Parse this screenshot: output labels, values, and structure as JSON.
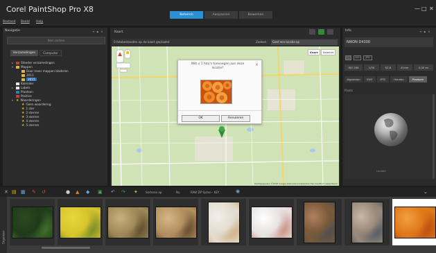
{
  "app": {
    "title": "Corel PaintShop Pro X8",
    "window_controls": [
      "—",
      "□",
      "✕"
    ],
    "tabs": [
      {
        "label": "Beheren",
        "active": true
      },
      {
        "label": "Aanpassen",
        "active": false
      },
      {
        "label": "Bewerken",
        "active": false
      }
    ],
    "menu": [
      "Bestand",
      "Beeld",
      "Help"
    ]
  },
  "navigator": {
    "title": "Navigatie",
    "panel_controls": "▾ ▪ ✕",
    "search_placeholder": "Niet zoeken",
    "tabs": [
      "Verzamelingen",
      "Computer"
    ],
    "tree": [
      {
        "label": "Sfeeder verzamelingen",
        "icon": "red",
        "tri": "▸",
        "indent": 0
      },
      {
        "label": "Mappen",
        "icon": "folder",
        "tri": "▾",
        "indent": 0
      },
      {
        "label": "Door meer mappen bladeren",
        "icon": "folder",
        "tri": "",
        "indent": 1
      },
      {
        "label": "2011",
        "icon": "folder",
        "tri": "",
        "indent": 1
      },
      {
        "label": "2015",
        "icon": "folder",
        "tri": "",
        "indent": 1,
        "selected": true
      },
      {
        "label": "Kalender",
        "icon": "white",
        "tri": "",
        "indent": 0
      },
      {
        "label": "Labels",
        "icon": "white",
        "tri": "▸",
        "indent": 0
      },
      {
        "label": "Plaatsen",
        "icon": "blue",
        "tri": "",
        "indent": 0
      },
      {
        "label": "Posities",
        "icon": "red",
        "tri": "",
        "indent": 0
      },
      {
        "label": "Waarderingen",
        "icon": "star",
        "tri": "▾",
        "indent": 0
      },
      {
        "label": "Geen waardering",
        "icon": "star",
        "tri": "",
        "indent": 1
      },
      {
        "label": "1 ster",
        "icon": "star",
        "tri": "",
        "indent": 1
      },
      {
        "label": "2 sterren",
        "icon": "star",
        "tri": "",
        "indent": 1
      },
      {
        "label": "3 sterren",
        "icon": "star",
        "tri": "",
        "indent": 1
      },
      {
        "label": "4 sterren",
        "icon": "star",
        "tri": "",
        "indent": 1
      },
      {
        "label": "5 sterren",
        "icon": "star",
        "tri": "",
        "indent": 1
      }
    ]
  },
  "map": {
    "title": "Kaart",
    "subtitle": "0 fotobestanden op de kaart geplaatst",
    "search_label": "Zoeken",
    "search_value": "Geef een locatie op",
    "map_types": [
      "Kaart",
      "Satelliet"
    ],
    "attribution": "Kaartgegevens ©2015 Google   Gebruiksvoorwaarden   Een kaartfout rapporteren",
    "dialog": {
      "text": "Wilt u 1 foto's toevoegen aan deze locatie?",
      "close": "×",
      "ok": "OK",
      "cancel": "Annuleren"
    }
  },
  "info": {
    "title": "Info",
    "camera": "NIKON D4300",
    "icons": [
      "ISO",
      "JPG"
    ],
    "exif": [
      "ISO 200",
      "1/30",
      "f/2,8",
      "8 mm",
      "0,00 ev"
    ],
    "tabs": [
      "Algemeen",
      "EXIF",
      "IPTC",
      "Herzien",
      "Plaatsen"
    ],
    "active_tab": "Plaatsen",
    "places_label": "Plaats",
    "location_label": "Locatie"
  },
  "toolbar": {
    "sort_label": "Sorteren op",
    "sort_icon_label": "Nu",
    "raw_label": "RAW ZIP lijsten · KEY"
  },
  "organizer": {
    "side_label": "Organizer",
    "thumbnails": [
      {
        "name": "leaf",
        "colors": [
          "#1f3a1a",
          "#4f7f32",
          "#2a4a1f"
        ]
      },
      {
        "name": "yellow-flower",
        "colors": [
          "#d8c52a",
          "#5a7a2a",
          "#e7d640"
        ]
      },
      {
        "name": "leopard-1",
        "colors": [
          "#a08a5a",
          "#4a3a22",
          "#c8b07a"
        ]
      },
      {
        "name": "leopard-2",
        "colors": [
          "#b49060",
          "#4a3a24",
          "#d4b888"
        ]
      },
      {
        "name": "woman-portrait",
        "colors": [
          "#e4ddd2",
          "#c9a06a",
          "#f3efe8"
        ]
      },
      {
        "name": "baby-hand",
        "colors": [
          "#e9e3e3",
          "#c47a6a",
          "#ffffff"
        ]
      },
      {
        "name": "venice-canal-1",
        "colors": [
          "#7a5a3a",
          "#3a4a5a",
          "#b08060"
        ]
      },
      {
        "name": "venice-canal-2",
        "colors": [
          "#9a8a7a",
          "#3a4a5a",
          "#c8b8a8"
        ]
      },
      {
        "name": "orange-roses",
        "colors": [
          "#e07a1a",
          "#b0400f",
          "#f2a040"
        ],
        "selected": true
      }
    ]
  }
}
